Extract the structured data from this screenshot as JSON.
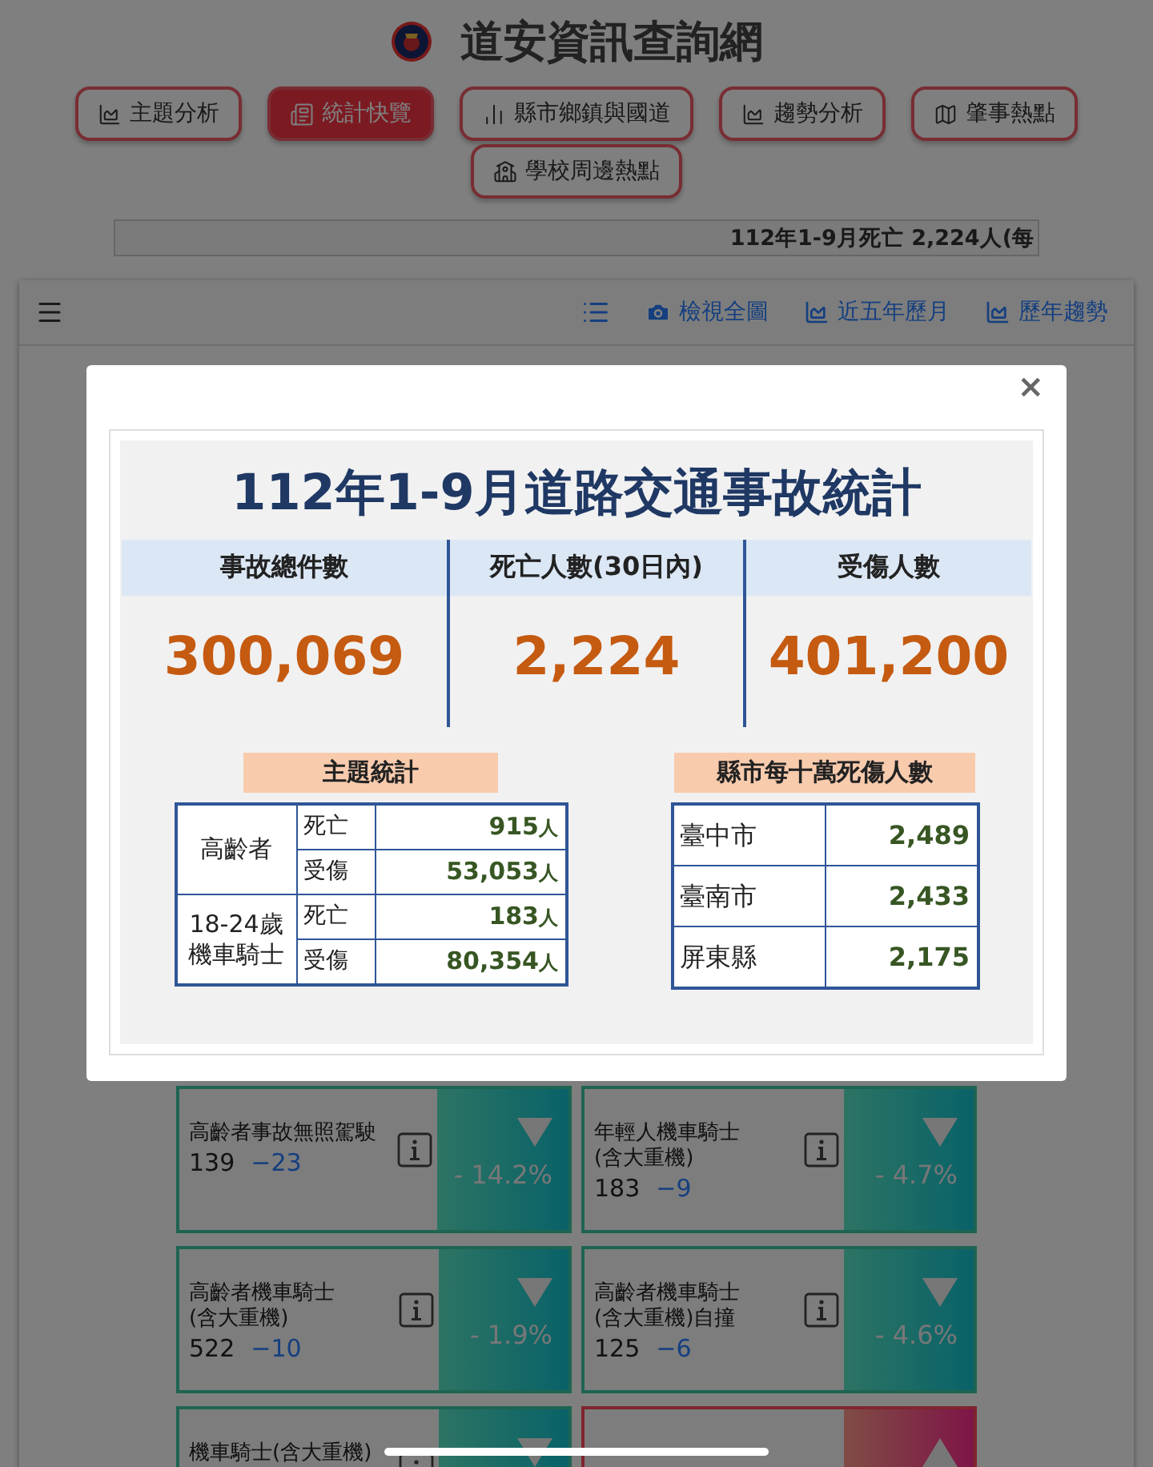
{
  "site": {
    "title": "道安資訊查詢網"
  },
  "nav": [
    {
      "label": "主題分析",
      "selected": false
    },
    {
      "label": "統計快覽",
      "selected": true
    },
    {
      "label": "縣市鄉鎮與國道",
      "selected": false
    },
    {
      "label": "趨勢分析",
      "selected": false
    },
    {
      "label": "肇事熱點",
      "selected": false
    },
    {
      "label": "學校周邊熱點",
      "selected": false
    }
  ],
  "marquee": "112年1-9月死亡 2,224人(每",
  "toolbar": [
    {
      "label": "檢視全圖"
    },
    {
      "label": "近五年歷月"
    },
    {
      "label": "歷年趨勢"
    }
  ],
  "modal": {
    "close": "×",
    "title": "112年1-9月道路交通事故統計",
    "summary": [
      {
        "label": "事故總件數",
        "value": "300,069"
      },
      {
        "label": "死亡人數(30日內)",
        "value": "2,224"
      },
      {
        "label": "受傷人數",
        "value": "401,200"
      }
    ],
    "theme": {
      "heading": "主題統計",
      "groups": [
        {
          "group": "高齡者",
          "rows": [
            {
              "label": "死亡",
              "value": "915",
              "unit": "人"
            },
            {
              "label": "受傷",
              "value": "53,053",
              "unit": "人"
            }
          ]
        },
        {
          "group": "18-24歲機車騎士",
          "rows": [
            {
              "label": "死亡",
              "value": "183",
              "unit": "人"
            },
            {
              "label": "受傷",
              "value": "80,354",
              "unit": "人"
            }
          ]
        }
      ]
    },
    "county": {
      "heading": "縣市每十萬死傷人數",
      "rows": [
        {
          "name": "臺中市",
          "value": "2,489"
        },
        {
          "name": "臺南市",
          "value": "2,433"
        },
        {
          "name": "屏東縣",
          "value": "2,175"
        }
      ]
    }
  },
  "cards": [
    {
      "title": "高齡者事故無照駕駛",
      "count": "139",
      "change": "−23",
      "percent": "- 14.2%",
      "kind": "down"
    },
    {
      "title": "年輕人機車騎士\n(含大重機)",
      "count": "183",
      "change": "−9",
      "percent": "- 4.7%",
      "kind": "down"
    },
    {
      "title": "高齡者機車騎士\n(含大重機)",
      "count": "522",
      "change": "−10",
      "percent": "- 1.9%",
      "kind": "down"
    },
    {
      "title": "高齡者機車騎士\n(含大重機)自撞",
      "count": "125",
      "change": "−6",
      "percent": "- 4.6%",
      "kind": "down"
    },
    {
      "title": "機車騎士(含大重機)",
      "kind": "down"
    },
    {
      "kind": "up"
    }
  ]
}
